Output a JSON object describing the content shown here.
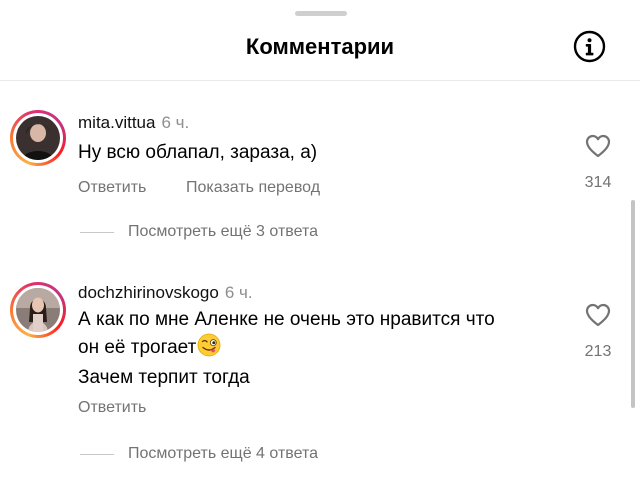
{
  "header": {
    "title": "Комментарии"
  },
  "comments": [
    {
      "username": "mita.vittua",
      "time": "6 ч.",
      "lines": [
        "Ну всю облапал, зараза, а)"
      ],
      "reply_label": "Ответить",
      "translate_label": "Показать перевод",
      "likes": "314",
      "view_replies": "Посмотреть ещё 3 ответа"
    },
    {
      "username": "dochzhirinovskogo",
      "time": "6 ч.",
      "lines": [
        "А как по мне Аленке не очень это нравится что",
        "он её трогает",
        "Зачем терпит тогда"
      ],
      "reply_label": "Ответить",
      "likes": "213",
      "view_replies": "Посмотреть ещё 4 ответа"
    }
  ],
  "icons": {
    "info": "info-icon",
    "like": "heart-icon",
    "emoji": "winking-face-with-tongue-emoji"
  },
  "colors": {
    "text": "#000000",
    "secondary": "#737373",
    "story_ring_start": "#fcaf45",
    "story_ring_end": "#c13584"
  }
}
